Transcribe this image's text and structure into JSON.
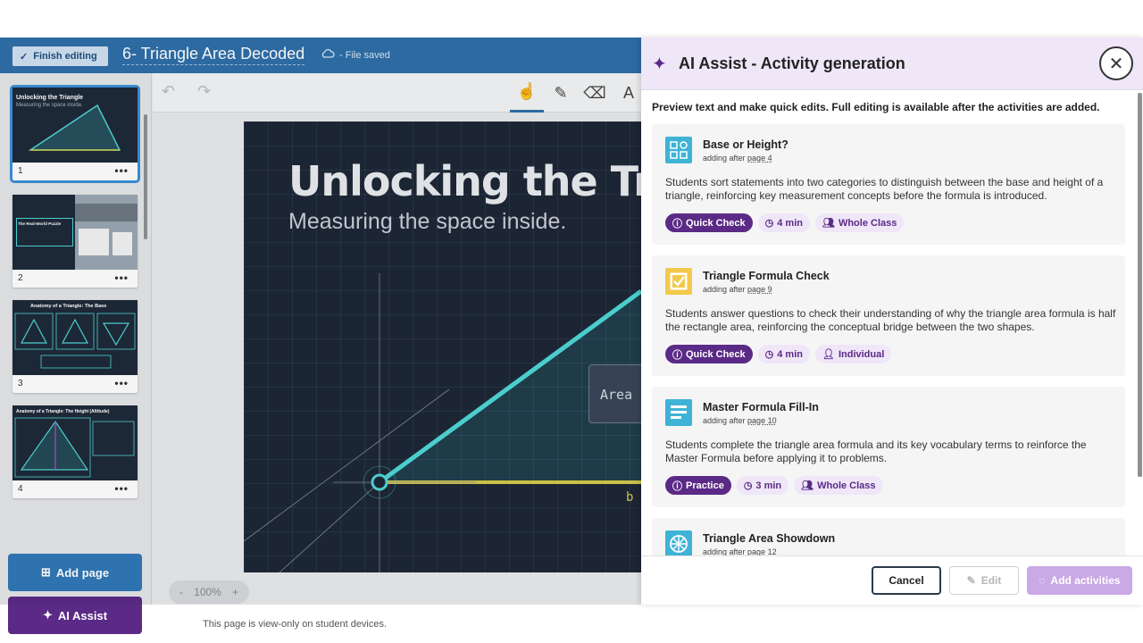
{
  "topbar": {
    "finish_label": "Finish editing",
    "doc_title": "6- Triangle Area Decoded",
    "save_status": "- File saved"
  },
  "sidebar": {
    "thumbs": [
      {
        "num": "1",
        "title": "Unlocking the Triangle",
        "subtitle": "Measuring the space inside."
      },
      {
        "num": "2",
        "title": "The Real-World Puzzle"
      },
      {
        "num": "3",
        "title": "Anatomy of a Triangle: The Base"
      },
      {
        "num": "4",
        "title": "Anatomy of a Triangle: The Height (Altitude)"
      }
    ],
    "add_page_label": "Add page",
    "ai_assist_label": "AI Assist"
  },
  "canvas": {
    "slide_title": "Unlocking the Triangle",
    "slide_subtitle": "Measuring the space inside.",
    "area_label": "Area",
    "b_label": "b",
    "zoom_minus": "-",
    "zoom_value": "100%",
    "zoom_plus": "+",
    "view_note": "This page is view-only on student devices."
  },
  "panel": {
    "title": "AI Assist - Activity generation",
    "close_glyph": "✕",
    "intro": "Preview text and make quick edits. Full editing is available after the activities are added.",
    "cards": [
      {
        "title": "Base or Height?",
        "sub_prefix": "adding after ",
        "sub_page": "page 4",
        "desc": "Students sort statements into two categories to distinguish between the base and height of a triangle, reinforcing key measurement concepts before the formula is introduced.",
        "type": "Quick Check",
        "time": "4 min",
        "group": "Whole Class",
        "icon": "sort-icon",
        "color": "#3fb3d6"
      },
      {
        "title": "Triangle Formula Check",
        "sub_prefix": "adding after ",
        "sub_page": "page 9",
        "desc": "Students answer questions to check their understanding of why the triangle area formula is half the rectangle area, reinforcing the conceptual bridge between the two shapes.",
        "type": "Quick Check",
        "time": "4 min",
        "group": "Individual",
        "icon": "checkbox-icon",
        "color": "#f2c94c"
      },
      {
        "title": "Master Formula Fill-In",
        "sub_prefix": "adding after ",
        "sub_page": "page 10",
        "desc": "Students complete the triangle area formula and its key vocabulary terms to reinforce the Master Formula before applying it to problems.",
        "type": "Practice",
        "time": "3 min",
        "group": "Whole Class",
        "icon": "fill-in-icon",
        "color": "#3fb3d6"
      },
      {
        "title": "Triangle Area Showdown",
        "sub_prefix": "adding after ",
        "sub_page": "page 12",
        "icon": "wheel-icon",
        "color": "#3fb3d6"
      }
    ],
    "footer": {
      "cancel_label": "Cancel",
      "edit_label": "Edit",
      "add_label": "Add activities"
    }
  }
}
